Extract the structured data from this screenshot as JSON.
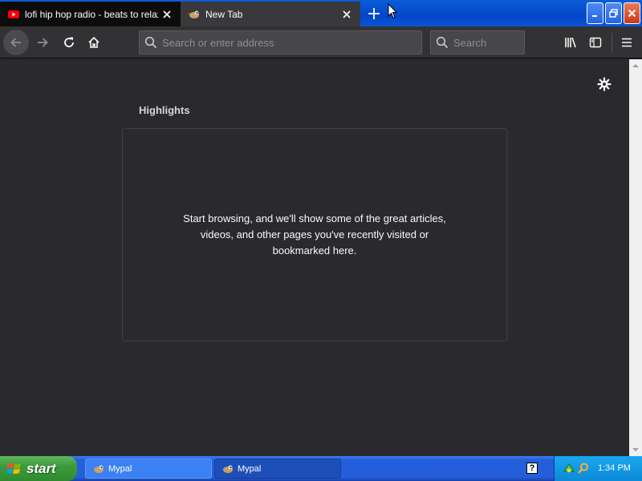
{
  "tabs": [
    {
      "label": "lofi hip hop radio - beats to relax/study to",
      "favicon": "youtube-icon",
      "active": false
    },
    {
      "label": "New Tab",
      "favicon": "mypal-icon",
      "active": true
    }
  ],
  "window_controls": [
    "minimize-icon",
    "restore-icon",
    "close-icon"
  ],
  "navbar": {
    "url_placeholder": "Search or enter address",
    "search_placeholder": "Search",
    "buttons": [
      "back-arrow-icon",
      "forward-arrow-icon",
      "reload-icon",
      "home-icon",
      "library-icon",
      "sidebar-icon",
      "hamburger-menu-icon"
    ]
  },
  "content": {
    "section_title": "Highlights",
    "empty_message": "Start browsing, and we'll show some of the great articles, videos, and other pages you've recently visited or bookmarked here."
  },
  "taskbar": {
    "start_label": "start",
    "tasks": [
      {
        "label": "Mypal",
        "icon": "mypal-icon",
        "active": false
      },
      {
        "label": "Mypal",
        "icon": "mypal-icon",
        "active": true
      }
    ],
    "help_glyph": "?",
    "clock": "1:34 PM"
  },
  "colors": {
    "titlebar_blue": "#0346c7",
    "content_bg": "#2a2a2e",
    "start_green": "#3c9a3c",
    "close_red": "#c8391a"
  }
}
